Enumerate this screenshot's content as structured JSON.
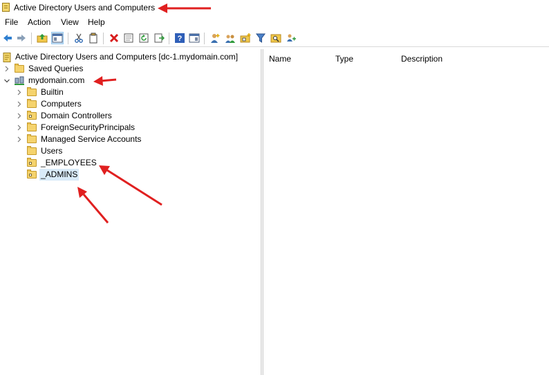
{
  "window": {
    "title": "Active Directory Users and Computers",
    "icon": "aduc-app-icon"
  },
  "menubar": {
    "items": [
      "File",
      "Action",
      "View",
      "Help"
    ]
  },
  "toolbar": {
    "buttons": [
      "back-icon",
      "forward-icon",
      "up-folder-icon",
      "show-hide-console-tree-icon",
      "cut-icon",
      "copy-icon",
      "delete-icon",
      "properties-icon",
      "refresh-icon",
      "export-list-icon",
      "help-icon",
      "show-hide-action-pane-icon",
      "new-user-icon",
      "new-group-icon",
      "new-ou-icon",
      "filter-icon",
      "find-icon",
      "add-to-group-icon"
    ]
  },
  "tree": {
    "root": {
      "label": "Active Directory Users and Computers [dc-1.mydomain.com]"
    },
    "saved_queries": {
      "label": "Saved Queries"
    },
    "domain": {
      "label": "mydomain.com"
    },
    "children": [
      {
        "label": "Builtin",
        "expandable": true,
        "type": "container"
      },
      {
        "label": "Computers",
        "expandable": true,
        "type": "container"
      },
      {
        "label": "Domain Controllers",
        "expandable": true,
        "type": "ou"
      },
      {
        "label": "ForeignSecurityPrincipals",
        "expandable": true,
        "type": "container"
      },
      {
        "label": "Managed Service Accounts",
        "expandable": true,
        "type": "container"
      },
      {
        "label": "Users",
        "expandable": false,
        "type": "container"
      },
      {
        "label": "_EMPLOYEES",
        "expandable": false,
        "type": "ou"
      },
      {
        "label": "_ADMINS",
        "expandable": false,
        "type": "ou",
        "selected": true
      }
    ]
  },
  "details": {
    "columns": [
      "Name",
      "Type",
      "Description"
    ]
  },
  "annotations": {
    "arrow_color": "#e02020"
  }
}
